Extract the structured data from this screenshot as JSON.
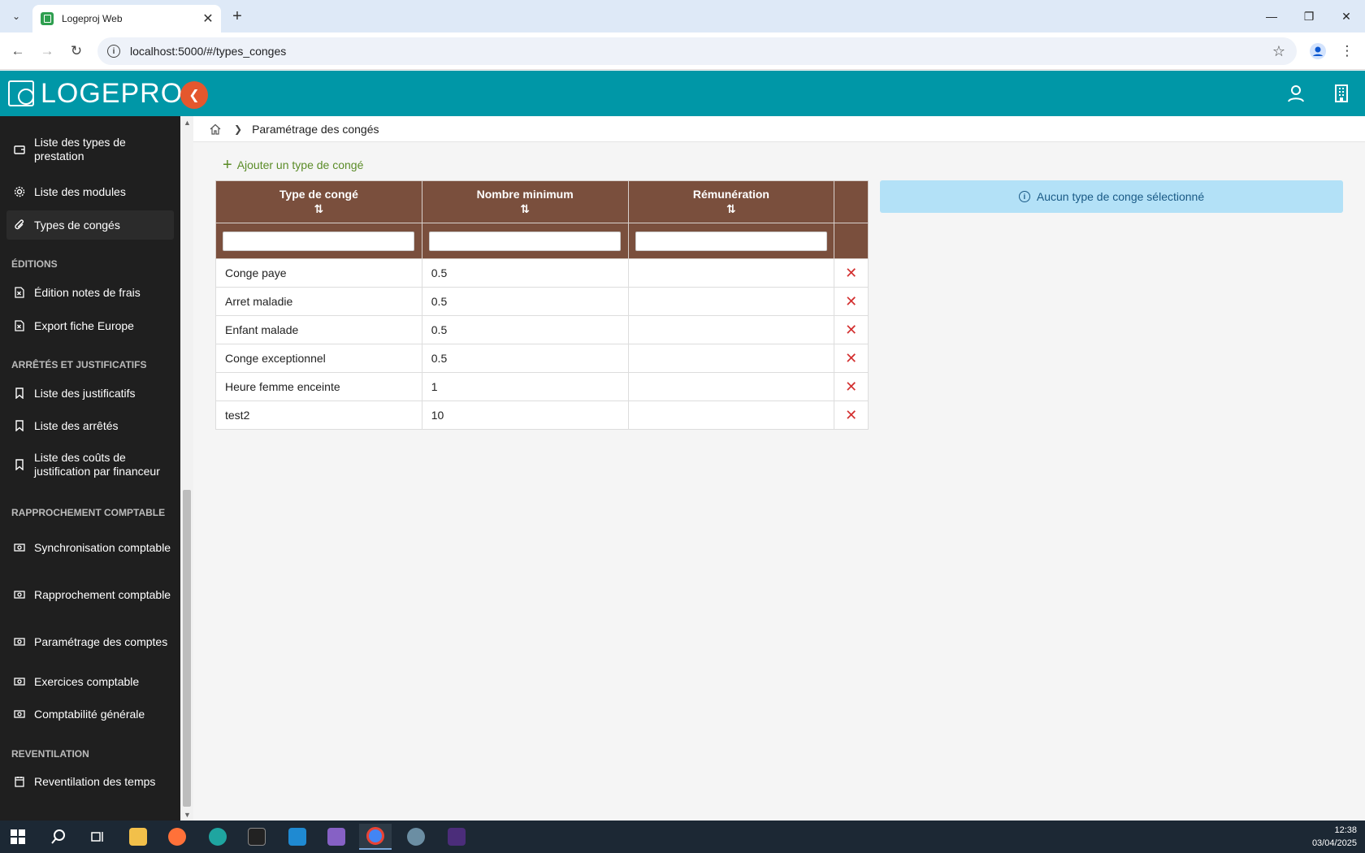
{
  "browser": {
    "tab_title": "Logeproj Web",
    "url": "localhost:5000/#/types_conges"
  },
  "app": {
    "logo_text": "LOGEPROJ"
  },
  "sidebar": {
    "items": [
      {
        "label": "Liste des types de prestation",
        "icon": "wallet-icon"
      },
      {
        "label": "Liste des modules",
        "icon": "gear-icon"
      },
      {
        "label": "Types de congés",
        "icon": "paperclip-icon",
        "active": true
      }
    ],
    "section_editions": "ÉDITIONS",
    "editions": [
      {
        "label": "Édition notes de frais",
        "icon": "excel-file-icon"
      },
      {
        "label": "Export fiche Europe",
        "icon": "excel-file-icon"
      }
    ],
    "section_arretes": "ARRÊTÉS ET JUSTIFICATIFS",
    "arretes": [
      {
        "label": "Liste des justificatifs",
        "icon": "bookmark-icon"
      },
      {
        "label": "Liste des arrêtés",
        "icon": "bookmark-icon"
      },
      {
        "label": "Liste des coûts de justification par financeur",
        "icon": "bookmark-icon"
      }
    ],
    "section_rapprochement": "RAPPROCHEMENT COMPTABLE",
    "rapprochement": [
      {
        "label": "Synchronisation comptable",
        "icon": "money-icon"
      },
      {
        "label": "Rapprochement comptable",
        "icon": "money-icon"
      },
      {
        "label": "Paramétrage des comptes",
        "icon": "money-icon"
      },
      {
        "label": "Exercices comptable",
        "icon": "money-icon"
      },
      {
        "label": "Comptabilité générale",
        "icon": "money-icon"
      }
    ],
    "section_reventilation": "REVENTILATION",
    "reventilation": [
      {
        "label": "Reventilation des temps",
        "icon": "calendar-icon"
      }
    ]
  },
  "breadcrumb": {
    "current": "Paramétrage des congés"
  },
  "main": {
    "add_label": "Ajouter un type de congé",
    "columns": [
      "Type de congé",
      "Nombre minimum",
      "Rémunération"
    ],
    "rows": [
      {
        "type": "Conge paye",
        "min": "0.5",
        "remu": ""
      },
      {
        "type": "Arret maladie",
        "min": "0.5",
        "remu": ""
      },
      {
        "type": "Enfant malade",
        "min": "0.5",
        "remu": ""
      },
      {
        "type": "Conge exceptionnel",
        "min": "0.5",
        "remu": ""
      },
      {
        "type": "Heure femme enceinte",
        "min": "1",
        "remu": ""
      },
      {
        "type": "test2",
        "min": "10",
        "remu": ""
      }
    ],
    "info_message": "Aucun type de conge sélectionné"
  },
  "taskbar": {
    "time": "12:38",
    "date": "03/04/2025"
  },
  "colors": {
    "header": "#0097a7",
    "table_header": "#7a4f3d",
    "accent_orange": "#e4572e",
    "add_green": "#5b8c28",
    "delete_red": "#d32f2f"
  }
}
